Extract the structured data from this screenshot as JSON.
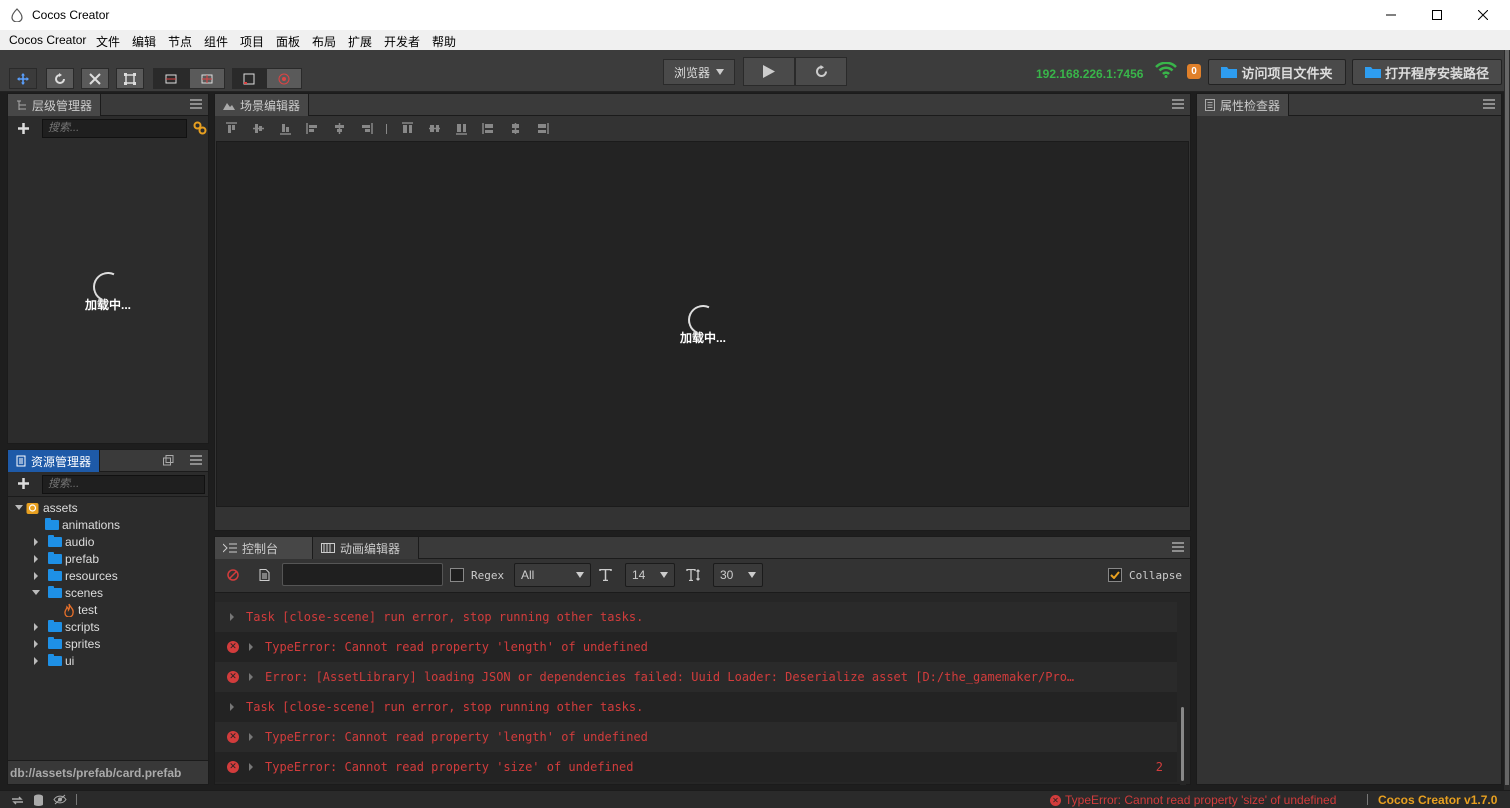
{
  "window": {
    "title": "Cocos Creator"
  },
  "menu": [
    "Cocos Creator",
    "文件",
    "编辑",
    "节点",
    "组件",
    "项目",
    "面板",
    "布局",
    "扩展",
    "开发者",
    "帮助"
  ],
  "toolbar": {
    "preview_mode": "浏览器",
    "ip": "192.168.226.1:7456",
    "badge": "0",
    "open_project_folder": "访问项目文件夹",
    "open_install_path": "打开程序安装路径"
  },
  "hierarchy": {
    "tab": "层级管理器",
    "search_placeholder": "搜索...",
    "loading": "加载中..."
  },
  "scene": {
    "tab": "场景编辑器",
    "loading": "加载中..."
  },
  "assets": {
    "tab": "资源管理器",
    "search_placeholder": "搜索...",
    "tree": [
      {
        "label": "assets",
        "level": 0,
        "expanded": true,
        "type": "db"
      },
      {
        "label": "animations",
        "level": 1,
        "expanded": null,
        "type": "folder"
      },
      {
        "label": "audio",
        "level": 1,
        "expanded": false,
        "type": "folder"
      },
      {
        "label": "prefab",
        "level": 1,
        "expanded": false,
        "type": "folder"
      },
      {
        "label": "resources",
        "level": 1,
        "expanded": false,
        "type": "folder"
      },
      {
        "label": "scenes",
        "level": 1,
        "expanded": true,
        "type": "folder"
      },
      {
        "label": "test",
        "level": 2,
        "expanded": null,
        "type": "scene"
      },
      {
        "label": "scripts",
        "level": 1,
        "expanded": false,
        "type": "folder"
      },
      {
        "label": "sprites",
        "level": 1,
        "expanded": false,
        "type": "folder"
      },
      {
        "label": "ui",
        "level": 1,
        "expanded": false,
        "type": "folder"
      }
    ],
    "selected_path": "db://assets/prefab/card.prefab"
  },
  "inspector": {
    "tab": "属性检查器"
  },
  "console": {
    "tab": "控制台",
    "tab2": "动画编辑器",
    "regex_label": "Regex",
    "filter": "All",
    "font_size": "14",
    "line_height": "30",
    "collapse_label": "Collapse",
    "logs": [
      {
        "icon": false,
        "text": "Task [close-scene] run error, stop running other tasks.",
        "count": ""
      },
      {
        "icon": true,
        "text": "TypeError: Cannot read property 'length' of undefined",
        "count": ""
      },
      {
        "icon": true,
        "text": "Error: [AssetLibrary] loading JSON or dependencies failed: Uuid Loader: Deserialize asset [D:/the_gamemaker/Pro…",
        "count": ""
      },
      {
        "icon": false,
        "text": "Task [close-scene] run error, stop running other tasks.",
        "count": ""
      },
      {
        "icon": true,
        "text": "TypeError: Cannot read property 'length' of undefined",
        "count": ""
      },
      {
        "icon": true,
        "text": "TypeError: Cannot read property 'size' of undefined",
        "count": "2"
      }
    ]
  },
  "status": {
    "error": "TypeError: Cannot read property 'size' of undefined",
    "version": "Cocos Creator v1.7.0"
  },
  "colors": {
    "accent": "#1e5aa8",
    "error": "#d23c3c",
    "ip": "#39b54a",
    "version": "#e8a020"
  }
}
